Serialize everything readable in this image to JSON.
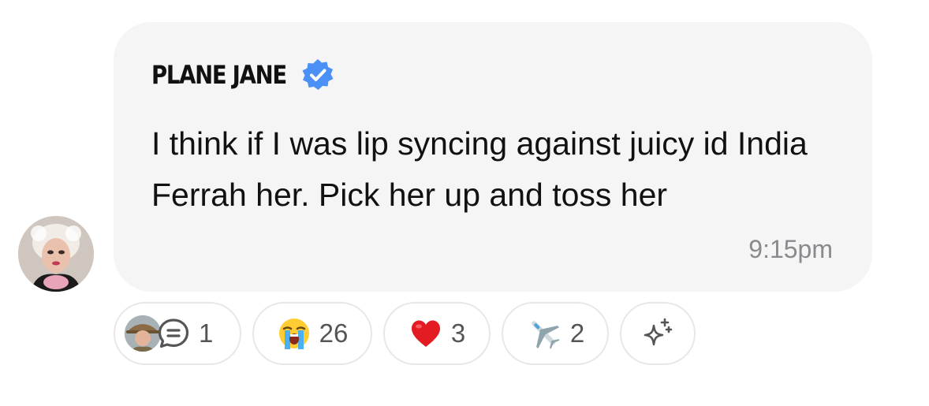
{
  "message": {
    "sender": "PLANE JANE",
    "verified": true,
    "text": "I think if I was lip syncing against juicy id India Ferrah her. Pick her up and toss her",
    "time": "9:15pm"
  },
  "reactions": [
    {
      "type": "thread-replies",
      "icon": "chat-bubble-icon",
      "count": "1"
    },
    {
      "type": "emoji",
      "icon": "loudly-crying-face",
      "count": "26"
    },
    {
      "type": "emoji",
      "icon": "red-heart",
      "count": "3"
    },
    {
      "type": "emoji",
      "icon": "airplane",
      "count": "2"
    },
    {
      "type": "add-reaction",
      "icon": "sparkles-icon"
    }
  ],
  "colors": {
    "bubble": "#f5f5f5",
    "text": "#111111",
    "timestamp": "#8a8a8e",
    "verified": "#4a90f5",
    "pill_border": "#e7e7e7"
  }
}
